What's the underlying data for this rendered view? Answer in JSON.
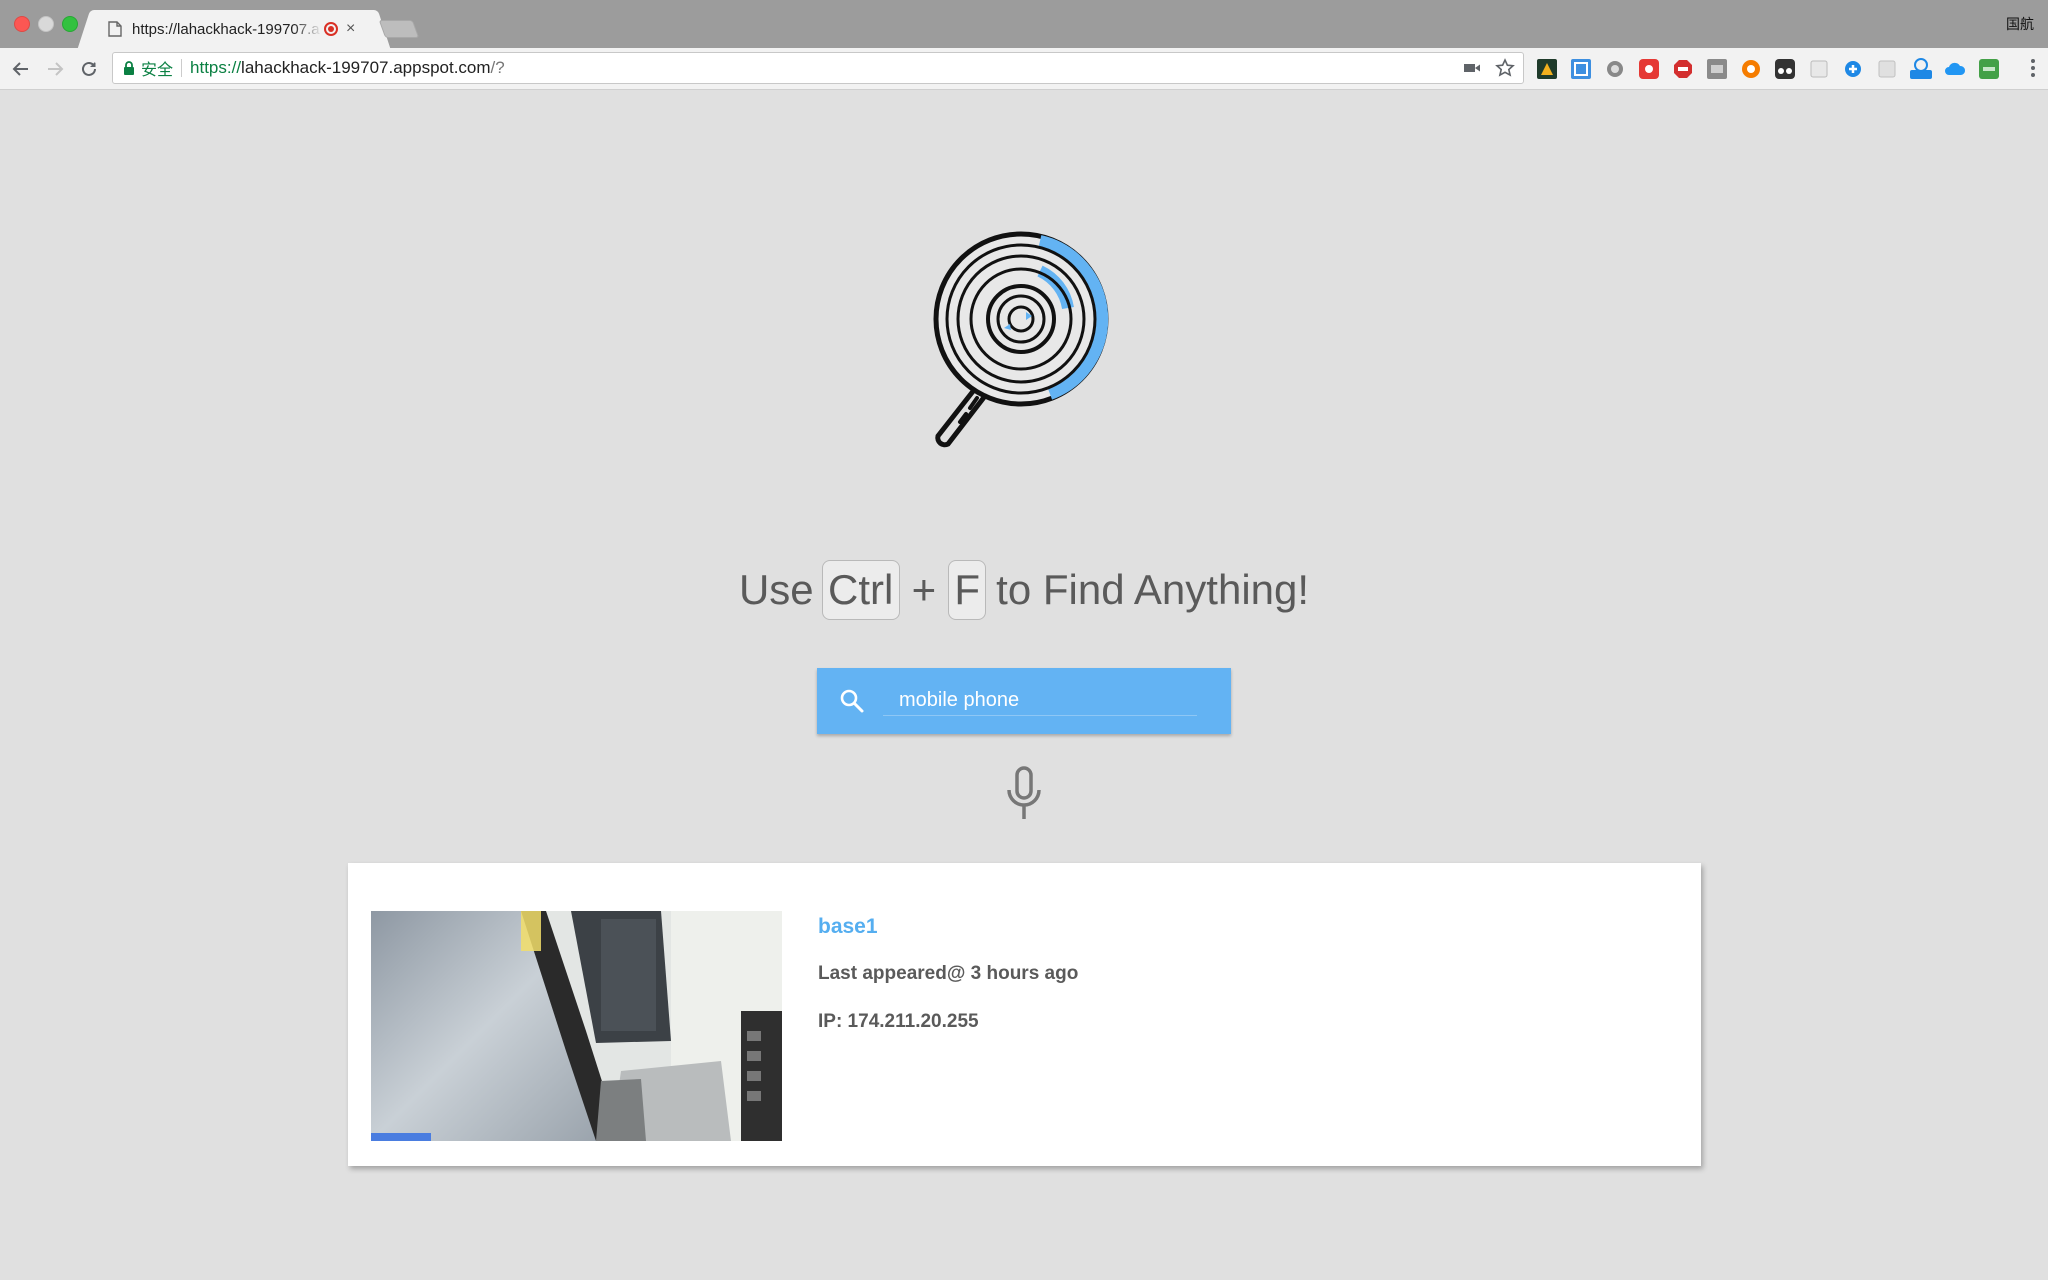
{
  "browser": {
    "tab_title": "https://lahackhack-199707.a",
    "tab_close": "×",
    "profile_name": "国航",
    "secure_label": "安全",
    "url_scheme": "https://",
    "url_host": "lahackhack-199707.appspot.com",
    "url_rest": "/?"
  },
  "page": {
    "headline_use": "Use",
    "key_ctrl": "Ctrl",
    "plus": "+",
    "key_f": "F",
    "headline_rest": "to Find Anything!",
    "search": {
      "value": "mobile phone",
      "placeholder": ""
    }
  },
  "result": {
    "title": "base1",
    "last_appeared": "Last appeared@ 3 hours ago",
    "ip": "IP: 174.211.20.255"
  },
  "colors": {
    "accent": "#63b3f3",
    "link": "#55aef0",
    "background": "#e0e0e0",
    "text": "#5a5a5a"
  },
  "icons": [
    "page-icon",
    "recording-icon",
    "back-icon",
    "forward-icon",
    "reload-icon",
    "lock-icon",
    "camera-icon",
    "star-icon",
    "search-icon",
    "microphone-icon",
    "more-icon"
  ]
}
